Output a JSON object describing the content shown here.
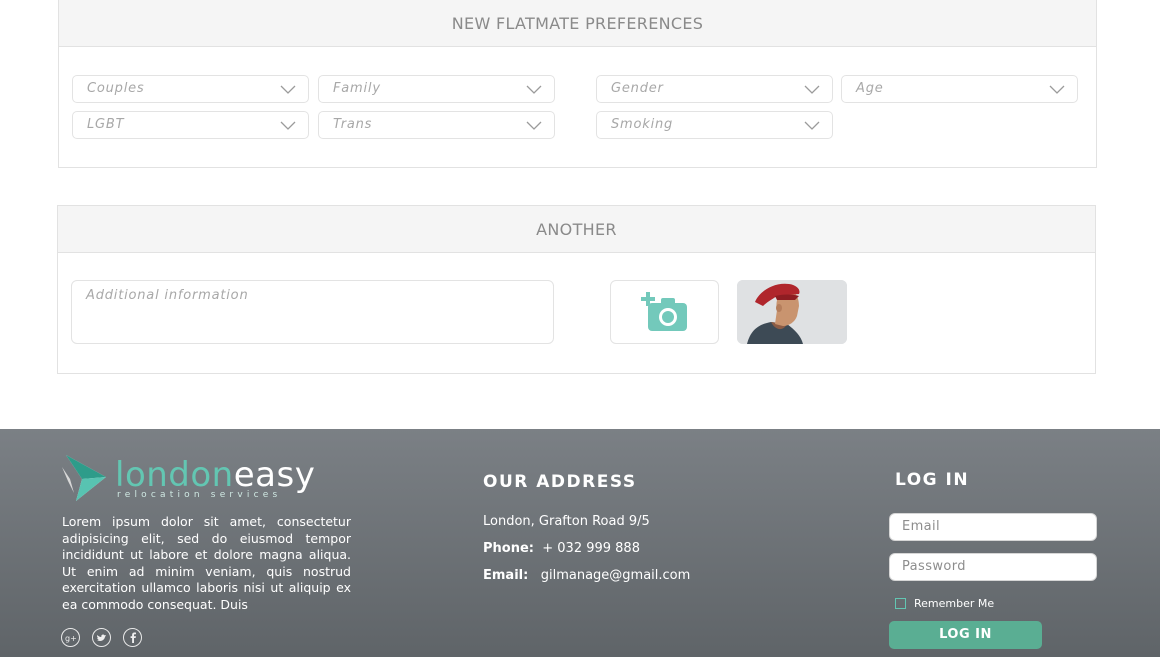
{
  "preferences": {
    "title": "NEW FLATMATE PREFERENCES",
    "selects": [
      {
        "label": "Couples"
      },
      {
        "label": "Family"
      },
      {
        "label": "Gender"
      },
      {
        "label": "Age"
      },
      {
        "label": "LGBT"
      },
      {
        "label": "Trans"
      },
      {
        "label": "Smoking"
      }
    ]
  },
  "another": {
    "title": "ANOTHER",
    "textarea_placeholder": "Additional information"
  },
  "footer": {
    "logo": {
      "part1": "london",
      "part2": "easy",
      "sub": "relocation services"
    },
    "about": "Lorem ipsum dolor sit amet, consectetur adipisicing elit, sed do eiusmod tempor incididunt ut labore et dolore magna aliqua. Ut enim ad minim veniam, quis nostrud exercitation ullamco laboris nisi ut aliquip ex ea commodo consequat. Duis",
    "address": {
      "title": "OUR ADDRESS",
      "street": "London, Grafton Road 9/5",
      "phone_label": "Phone:",
      "phone": "+ 032 999 888",
      "email_label": "Email:",
      "email": "gilmanage@gmail.com"
    },
    "login": {
      "title": "LOG IN",
      "email_placeholder": "Email",
      "password_placeholder": "Password",
      "remember": "Remember Me",
      "button": "LOG IN"
    }
  },
  "colors": {
    "accent": "#63c6b2",
    "button": "#5aae93",
    "footer": "#6e7378"
  }
}
